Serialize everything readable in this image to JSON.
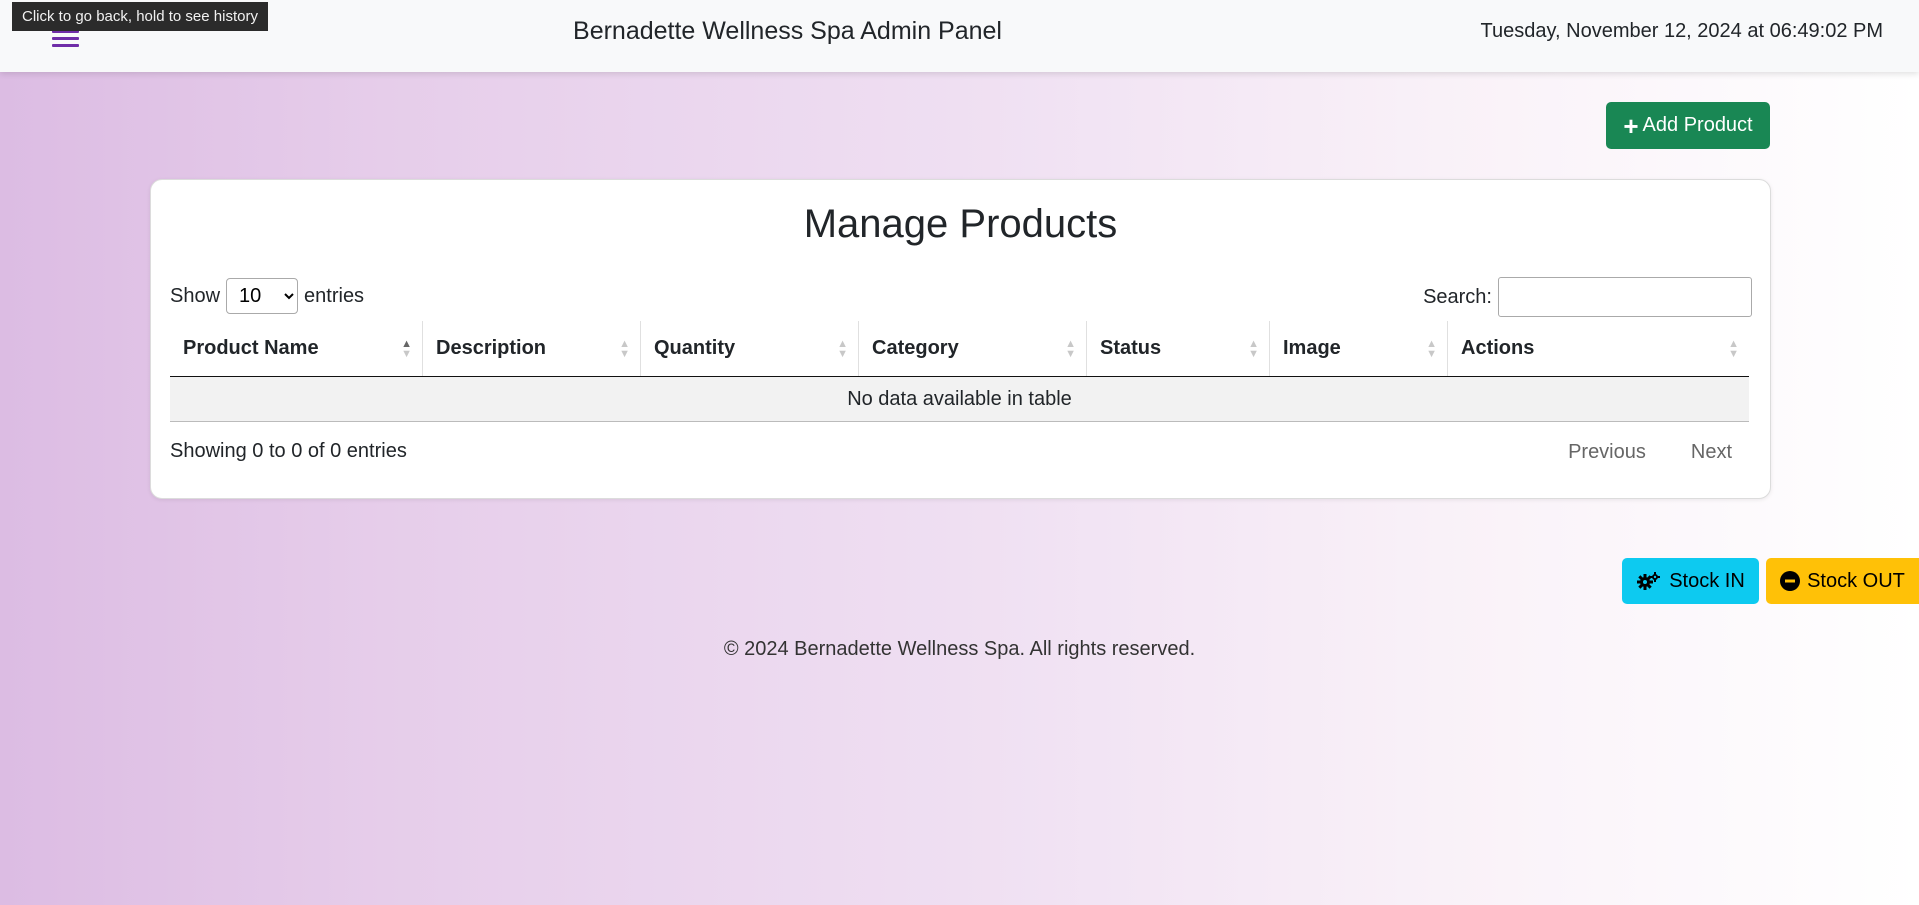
{
  "header": {
    "title": "Bernadette Wellness Spa Admin Panel",
    "datetime": "Tuesday, November 12, 2024 at 06:49:02 PM",
    "tooltip": "Click to go back, hold to see history"
  },
  "toolbar": {
    "add_label": "Add Product"
  },
  "card": {
    "title": "Manage Products",
    "length_prefix": "Show",
    "length_value": "10",
    "length_suffix": "entries",
    "search_label": "Search:",
    "columns": [
      "Product Name",
      "Description",
      "Quantity",
      "Category",
      "Status",
      "Image",
      "Actions"
    ],
    "empty_message": "No data available in table",
    "info": "Showing 0 to 0 of 0 entries",
    "prev_label": "Previous",
    "next_label": "Next"
  },
  "stock": {
    "in_label": "Stock IN",
    "out_label": "Stock OUT"
  },
  "footer": {
    "text": "© 2024 Bernadette Wellness Spa. All rights reserved."
  },
  "colors": {
    "add": "#198754",
    "stock_in": "#0dcaf0",
    "stock_out": "#ffc107",
    "menu": "#6f2da8"
  },
  "icons": {
    "add": "plus-icon",
    "stock_in": "gears-icon",
    "stock_out": "minus-circle-icon"
  }
}
